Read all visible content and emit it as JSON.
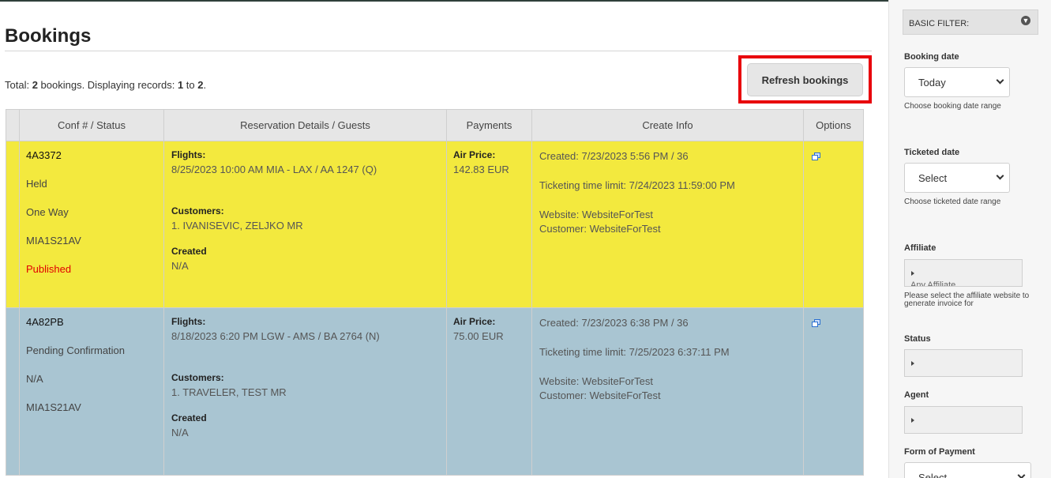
{
  "page": {
    "title": "Bookings",
    "summary_prefix": "Total: ",
    "summary_total": "2",
    "summary_mid": " bookings. Displaying records: ",
    "summary_from": "1",
    "summary_to_word": " to ",
    "summary_to": "2",
    "summary_end": "."
  },
  "toolbar": {
    "refresh_label": "Refresh bookings"
  },
  "table": {
    "headers": [
      "Conf # / Status",
      "Reservation Details / Guests",
      "Payments",
      "Create Info",
      "Options"
    ],
    "rows": [
      {
        "conf": "4A3372",
        "status": "Held",
        "trip_type": "One Way",
        "pnr": "MIA1S21AV",
        "publish_state": "Published",
        "flights_label": "Flights:",
        "flight": "8/25/2023  10:00 AM MIA - LAX / AA 1247 (Q)",
        "customers_label": "Customers:",
        "customer": "1. IVANISEVIC, ZELJKO MR",
        "created_label": "Created",
        "created_value": "N/A",
        "price_label": "Air Price:",
        "price": "142.83 EUR",
        "created_info": "Created: 7/23/2023 5:56 PM / 36",
        "ticketing_limit": "Ticketing time limit: 7/24/2023 11:59:00 PM",
        "website": "Website: WebsiteForTest",
        "customer_site": "Customer: WebsiteForTest",
        "row_color": "#f3e93e"
      },
      {
        "conf": "4A82PB",
        "status": "Pending Confirmation",
        "trip_type": "N/A",
        "pnr": "MIA1S21AV",
        "publish_state": "",
        "flights_label": "Flights:",
        "flight": "8/18/2023  6:20 PM LGW - AMS / BA 2764 (N)",
        "customers_label": "Customers:",
        "customer": "1. TRAVELER, TEST MR",
        "created_label": "Created",
        "created_value": "N/A",
        "price_label": "Air Price:",
        "price": "75.00 EUR",
        "created_info": "Created: 7/23/2023 6:38 PM / 36",
        "ticketing_limit": "Ticketing time limit: 7/25/2023 6:37:11 PM",
        "website": "Website: WebsiteForTest",
        "customer_site": "Customer: WebsiteForTest",
        "row_color": "#a9c5d2"
      }
    ]
  },
  "sidebar": {
    "filter_title": "BASIC FILTER:",
    "booking_date_label": "Booking date",
    "booking_date_value": "Today",
    "booking_date_help": "Choose booking date range",
    "ticketed_date_label": "Ticketed date",
    "ticketed_date_value": "Select",
    "ticketed_date_help": "Choose ticketed date range",
    "affiliate_label": "Affiliate",
    "affiliate_clipped_text": "Any Affiliate",
    "affiliate_help": "Please select the affiliate website to generate invoice for",
    "status_label": "Status",
    "agent_label": "Agent",
    "form_of_payment_label": "Form of Payment",
    "form_of_payment_value": "Select"
  },
  "colors": {
    "highlight_border": "#e8000b",
    "published_text": "#e10000",
    "held_row": "#f3e93e",
    "pending_row": "#a9c5d2"
  }
}
